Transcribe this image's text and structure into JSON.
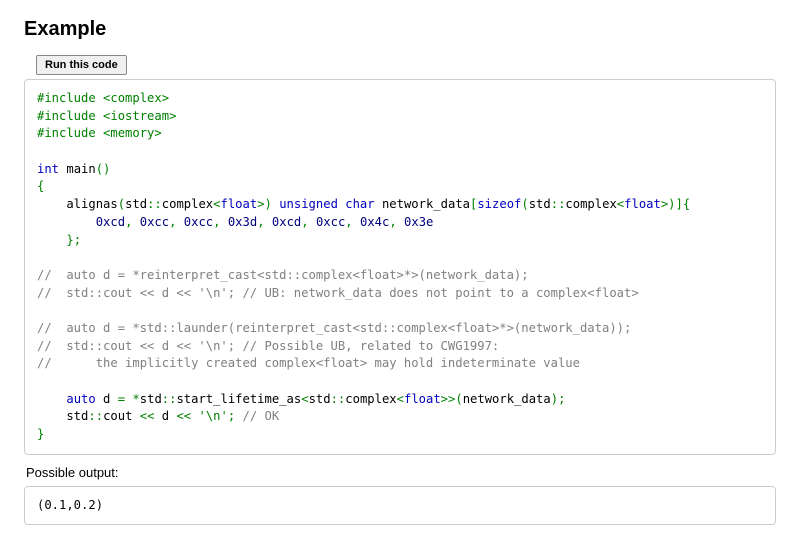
{
  "heading": "Example",
  "run_button": "Run this code",
  "output_label": "Possible output:",
  "output_text": "(0.1,0.2)",
  "code_tokens": [
    [
      {
        "c": "pp",
        "t": "#include <complex>"
      }
    ],
    [
      {
        "c": "pp",
        "t": "#include <iostream>"
      }
    ],
    [
      {
        "c": "pp",
        "t": "#include <memory>"
      }
    ],
    [],
    [
      {
        "c": "kw",
        "t": "int"
      },
      {
        "c": "id",
        "t": " main"
      },
      {
        "c": "punc",
        "t": "()"
      }
    ],
    [
      {
        "c": "punc",
        "t": "{"
      }
    ],
    [
      {
        "c": "id",
        "t": "    alignas"
      },
      {
        "c": "punc",
        "t": "("
      },
      {
        "c": "id",
        "t": "std"
      },
      {
        "c": "punc",
        "t": "::"
      },
      {
        "c": "id",
        "t": "complex"
      },
      {
        "c": "punc",
        "t": "<"
      },
      {
        "c": "kw",
        "t": "float"
      },
      {
        "c": "punc",
        "t": ">)"
      },
      {
        "c": "id",
        "t": " "
      },
      {
        "c": "kw",
        "t": "unsigned"
      },
      {
        "c": "id",
        "t": " "
      },
      {
        "c": "kw",
        "t": "char"
      },
      {
        "c": "id",
        "t": " network_data"
      },
      {
        "c": "punc",
        "t": "["
      },
      {
        "c": "kw",
        "t": "sizeof"
      },
      {
        "c": "punc",
        "t": "("
      },
      {
        "c": "id",
        "t": "std"
      },
      {
        "c": "punc",
        "t": "::"
      },
      {
        "c": "id",
        "t": "complex"
      },
      {
        "c": "punc",
        "t": "<"
      },
      {
        "c": "kw",
        "t": "float"
      },
      {
        "c": "punc",
        "t": ">)]{"
      }
    ],
    [
      {
        "c": "id",
        "t": "        "
      },
      {
        "c": "num",
        "t": "0xcd"
      },
      {
        "c": "punc",
        "t": ", "
      },
      {
        "c": "num",
        "t": "0xcc"
      },
      {
        "c": "punc",
        "t": ", "
      },
      {
        "c": "num",
        "t": "0xcc"
      },
      {
        "c": "punc",
        "t": ", "
      },
      {
        "c": "num",
        "t": "0x3d"
      },
      {
        "c": "punc",
        "t": ", "
      },
      {
        "c": "num",
        "t": "0xcd"
      },
      {
        "c": "punc",
        "t": ", "
      },
      {
        "c": "num",
        "t": "0xcc"
      },
      {
        "c": "punc",
        "t": ", "
      },
      {
        "c": "num",
        "t": "0x4c"
      },
      {
        "c": "punc",
        "t": ", "
      },
      {
        "c": "num",
        "t": "0x3e"
      }
    ],
    [
      {
        "c": "id",
        "t": "    "
      },
      {
        "c": "punc",
        "t": "};"
      }
    ],
    [],
    [
      {
        "c": "cmt",
        "t": "//  auto d = *reinterpret_cast<std::complex<float>*>(network_data);"
      }
    ],
    [
      {
        "c": "cmt",
        "t": "//  std::cout << d << '\\n'; // UB: network_data does not point to a complex<float>"
      }
    ],
    [],
    [
      {
        "c": "cmt",
        "t": "//  auto d = *std::launder(reinterpret_cast<std::complex<float>*>(network_data));"
      }
    ],
    [
      {
        "c": "cmt",
        "t": "//  std::cout << d << '\\n'; // Possible UB, related to CWG1997:"
      }
    ],
    [
      {
        "c": "cmt",
        "t": "//      the implicitly created complex<float> may hold indeterminate value"
      }
    ],
    [],
    [
      {
        "c": "id",
        "t": "    "
      },
      {
        "c": "kw",
        "t": "auto"
      },
      {
        "c": "id",
        "t": " d "
      },
      {
        "c": "punc",
        "t": "="
      },
      {
        "c": "id",
        "t": " "
      },
      {
        "c": "punc",
        "t": "*"
      },
      {
        "c": "id",
        "t": "std"
      },
      {
        "c": "punc",
        "t": "::"
      },
      {
        "c": "id",
        "t": "start_lifetime_as"
      },
      {
        "c": "punc",
        "t": "<"
      },
      {
        "c": "id",
        "t": "std"
      },
      {
        "c": "punc",
        "t": "::"
      },
      {
        "c": "id",
        "t": "complex"
      },
      {
        "c": "punc",
        "t": "<"
      },
      {
        "c": "kw",
        "t": "float"
      },
      {
        "c": "punc",
        "t": ">>("
      },
      {
        "c": "id",
        "t": "network_data"
      },
      {
        "c": "punc",
        "t": ");"
      }
    ],
    [
      {
        "c": "id",
        "t": "    std"
      },
      {
        "c": "punc",
        "t": "::"
      },
      {
        "c": "id",
        "t": "cout "
      },
      {
        "c": "punc",
        "t": "<<"
      },
      {
        "c": "id",
        "t": " d "
      },
      {
        "c": "punc",
        "t": "<<"
      },
      {
        "c": "id",
        "t": " "
      },
      {
        "c": "str",
        "t": "'\\n'"
      },
      {
        "c": "punc",
        "t": ";"
      },
      {
        "c": "id",
        "t": " "
      },
      {
        "c": "cmt",
        "t": "// OK"
      }
    ],
    [
      {
        "c": "punc",
        "t": "}"
      }
    ]
  ]
}
